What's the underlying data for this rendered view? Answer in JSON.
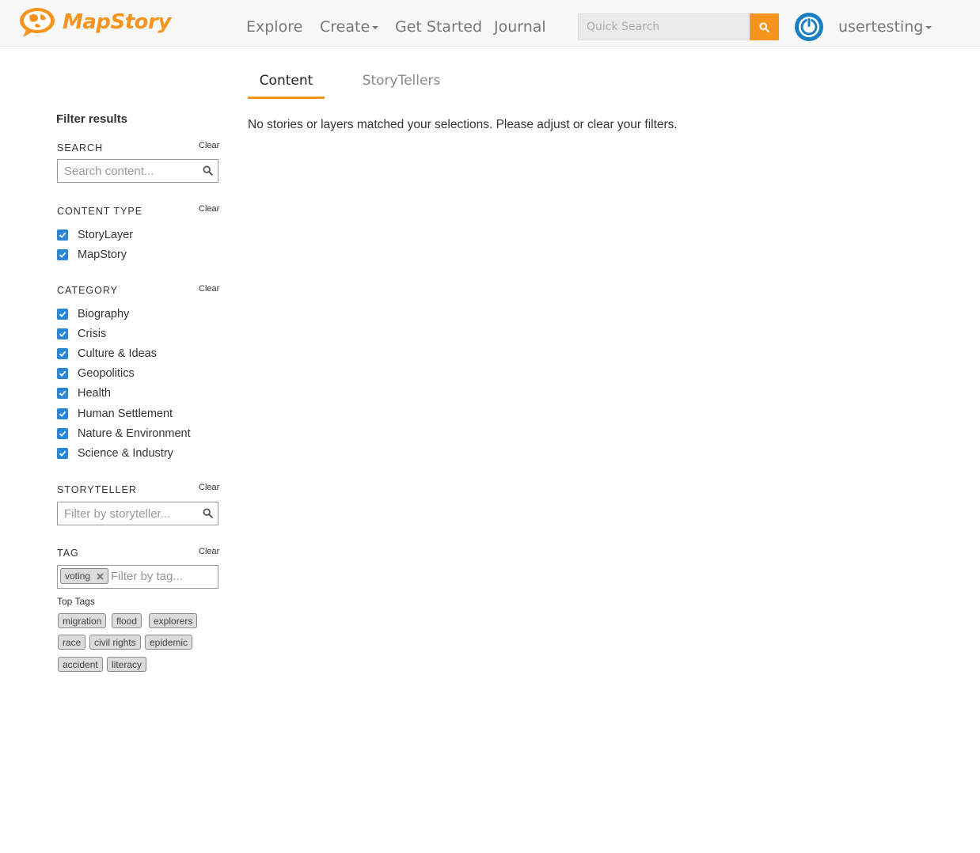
{
  "header": {
    "brand": "MapStory",
    "nav": {
      "explore": "Explore",
      "create": "Create",
      "get_started": "Get Started",
      "journal": "Journal"
    },
    "quick_search_placeholder": "Quick Search",
    "username": "usertesting",
    "accent_color": "#f7941d"
  },
  "tabs": {
    "content": "Content",
    "storytellers": "StoryTellers",
    "active": "Content"
  },
  "main": {
    "empty_message": "No stories or layers matched your selections. Please adjust or clear your filters."
  },
  "sidebar": {
    "title": "Filter results",
    "clear_label": "Clear",
    "search": {
      "label": "SEARCH",
      "placeholder": "Search content..."
    },
    "content_type": {
      "label": "CONTENT TYPE",
      "options": [
        {
          "label": "StoryLayer",
          "checked": true
        },
        {
          "label": "MapStory",
          "checked": true
        }
      ]
    },
    "category": {
      "label": "CATEGORY",
      "options": [
        {
          "label": "Biography",
          "checked": true
        },
        {
          "label": "Crisis",
          "checked": true
        },
        {
          "label": "Culture & Ideas",
          "checked": true
        },
        {
          "label": "Geopolitics",
          "checked": true
        },
        {
          "label": "Health",
          "checked": true
        },
        {
          "label": "Human Settlement",
          "checked": true
        },
        {
          "label": "Nature & Environment",
          "checked": true
        },
        {
          "label": "Science & Industry",
          "checked": true
        }
      ]
    },
    "storyteller": {
      "label": "STORYTELLER",
      "placeholder": "Filter by storyteller..."
    },
    "tag": {
      "label": "TAG",
      "selected": [
        "voting"
      ],
      "placeholder": "Filter by tag...",
      "top_tags_label": "Top Tags",
      "top_tags": [
        "migration",
        "flood",
        "explorers",
        "race",
        "civil rights",
        "epidemic",
        "accident",
        "literacy"
      ]
    }
  }
}
